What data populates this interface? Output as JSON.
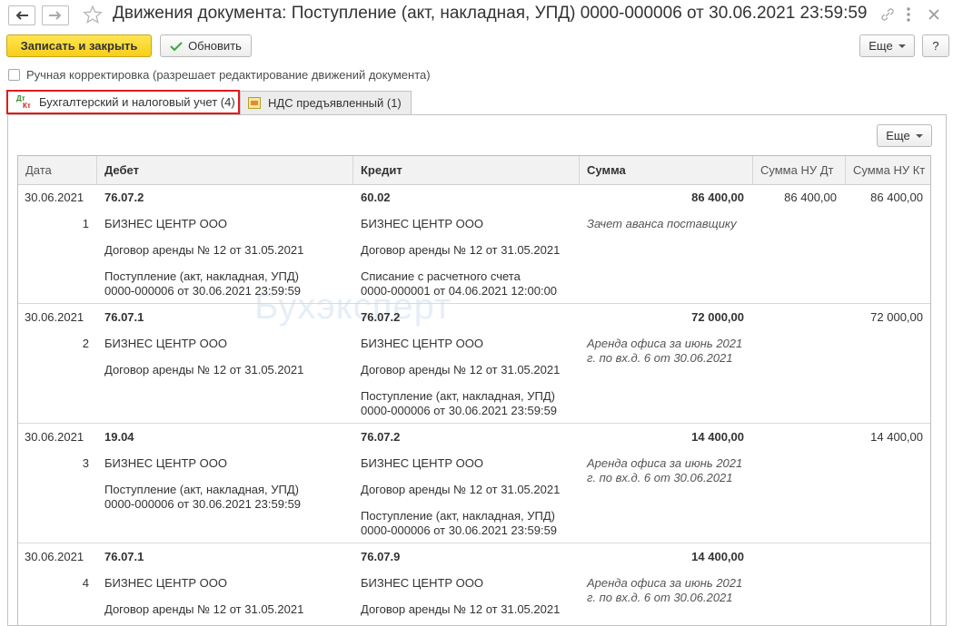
{
  "window": {
    "title": "Движения документа: Поступление (акт, накладная, УПД) 0000-000006 от 30.06.2021 23:59:59"
  },
  "toolbar": {
    "save_close_label": "Записать и закрыть",
    "refresh_label": "Обновить",
    "more_label": "Еще",
    "help_label": "?"
  },
  "manual_correction": {
    "label": "Ручная корректировка (разрешает редактирование движений документа)",
    "checked": false
  },
  "tabs": [
    {
      "label": "Бухгалтерский и налоговый учет (4)",
      "icon_text": "Дт Кт"
    },
    {
      "label": "НДС предъявленный (1)"
    }
  ],
  "panel": {
    "more_label": "Еще"
  },
  "watermark": "Бухэксперт",
  "table": {
    "headers": {
      "date": "Дата",
      "debit": "Дебет",
      "credit": "Кредит",
      "sum": "Сумма",
      "sum_nu_dt": "Сумма НУ Дт",
      "sum_nu_kt": "Сумма НУ Кт"
    },
    "rows": [
      {
        "date": "30.06.2021",
        "num": "1",
        "debit_account": "76.07.2",
        "debit_sub": [
          "БИЗНЕС ЦЕНТР ООО",
          "Договор аренды № 12 от 31.05.2021",
          "Поступление (акт, накладная, УПД)",
          "0000-000006 от 30.06.2021 23:59:59"
        ],
        "credit_account": "60.02",
        "credit_sub": [
          "БИЗНЕС ЦЕНТР ООО",
          "Договор аренды № 12 от 31.05.2021",
          "Списание с расчетного счета",
          "0000-000001 от 04.06.2021 12:00:00"
        ],
        "sum": "86 400,00",
        "content": [
          "Зачет аванса поставщику"
        ],
        "sum_nu_dt": "86 400,00",
        "sum_nu_kt": "86 400,00"
      },
      {
        "date": "30.06.2021",
        "num": "2",
        "debit_account": "76.07.1",
        "debit_sub": [
          "БИЗНЕС ЦЕНТР ООО",
          "Договор аренды № 12 от 31.05.2021",
          "",
          ""
        ],
        "credit_account": "76.07.2",
        "credit_sub": [
          "БИЗНЕС ЦЕНТР ООО",
          "Договор аренды № 12 от 31.05.2021",
          "Поступление (акт, накладная, УПД)",
          "0000-000006 от 30.06.2021 23:59:59"
        ],
        "sum": "72 000,00",
        "content": [
          "Аренда офиса за июнь 2021",
          "г. по вх.д. 6 от 30.06.2021"
        ],
        "sum_nu_dt": "",
        "sum_nu_kt": "72 000,00"
      },
      {
        "date": "30.06.2021",
        "num": "3",
        "debit_account": "19.04",
        "debit_sub": [
          "БИЗНЕС ЦЕНТР ООО",
          "Поступление (акт, накладная, УПД)",
          "0000-000006 от 30.06.2021 23:59:59",
          ""
        ],
        "credit_account": "76.07.2",
        "credit_sub": [
          "БИЗНЕС ЦЕНТР ООО",
          "Договор аренды № 12 от 31.05.2021",
          "Поступление (акт, накладная, УПД)",
          "0000-000006 от 30.06.2021 23:59:59"
        ],
        "sum": "14 400,00",
        "content": [
          "Аренда офиса за июнь 2021",
          "г. по вх.д. 6 от 30.06.2021"
        ],
        "sum_nu_dt": "",
        "sum_nu_kt": "14 400,00"
      },
      {
        "date": "30.06.2021",
        "num": "4",
        "debit_account": "76.07.1",
        "debit_sub": [
          "БИЗНЕС ЦЕНТР ООО",
          "Договор аренды № 12 от 31.05.2021",
          "",
          ""
        ],
        "credit_account": "76.07.9",
        "credit_sub": [
          "БИЗНЕС ЦЕНТР ООО",
          "Договор аренды № 12 от 31.05.2021",
          "",
          ""
        ],
        "sum": "14 400,00",
        "content": [
          "Аренда офиса за июнь 2021",
          "г. по вх.д. 6 от 30.06.2021"
        ],
        "sum_nu_dt": "",
        "sum_nu_kt": ""
      }
    ]
  }
}
